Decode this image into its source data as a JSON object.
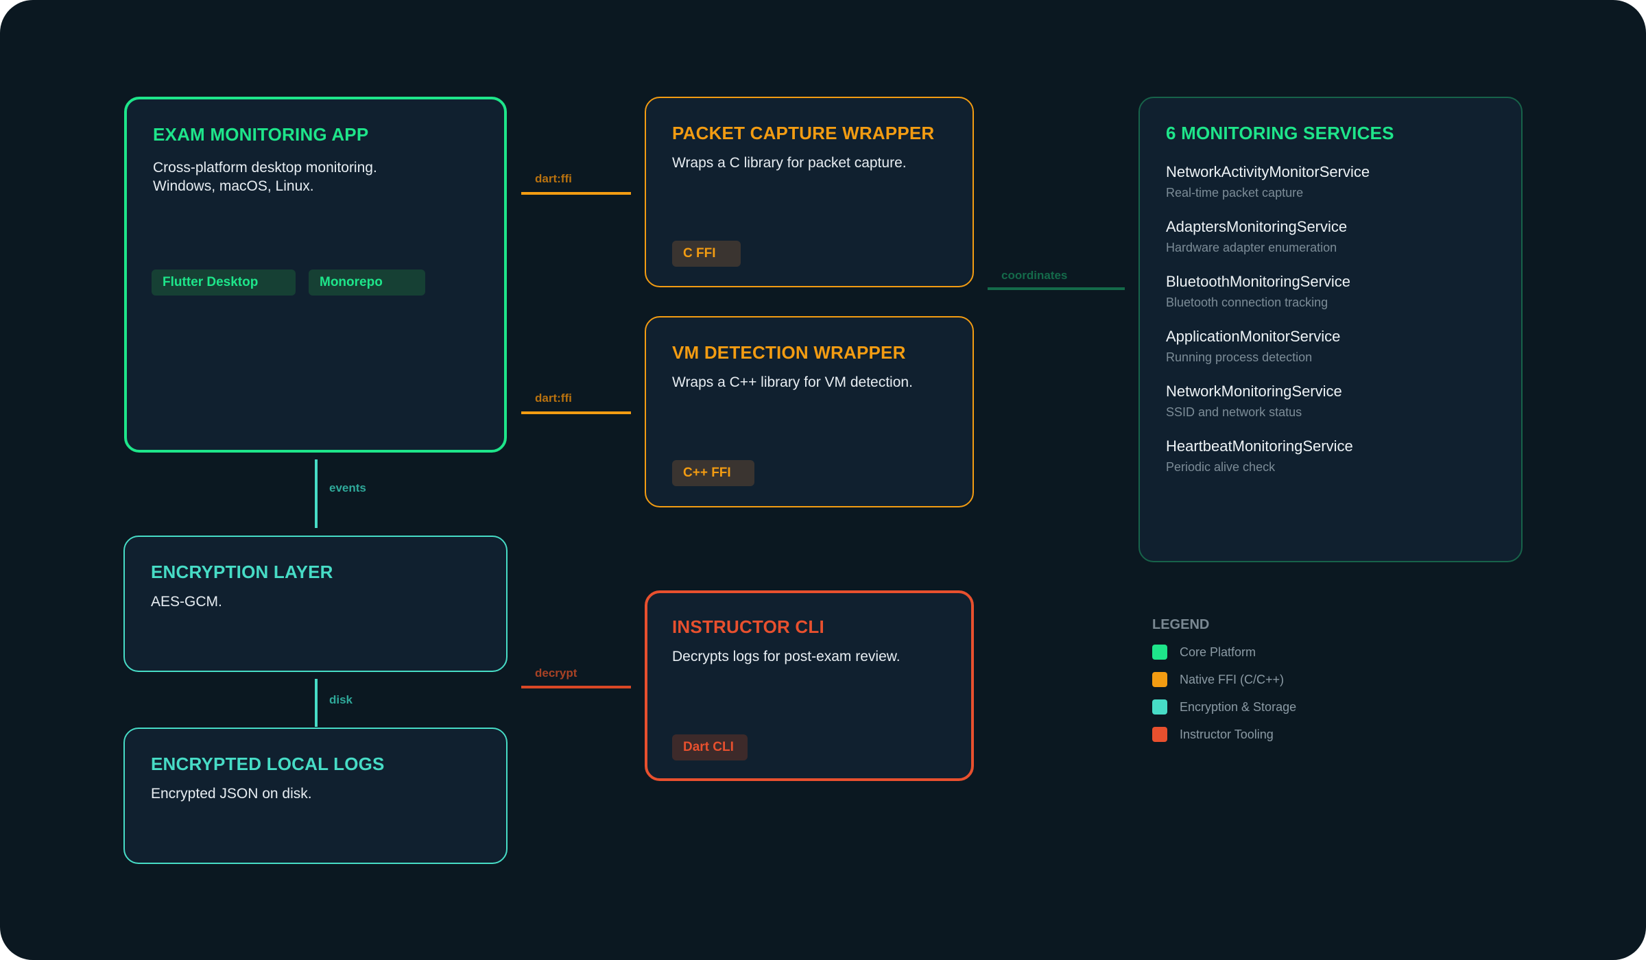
{
  "colors": {
    "background": "#0b1821",
    "core_green": "#1ee58a",
    "ffi_orange": "#f39c12",
    "encryption_teal": "#47dcc6",
    "instructor_red": "#e8502e"
  },
  "app": {
    "title": "EXAM MONITORING APP",
    "description": "Cross-platform desktop monitoring.\nWindows, macOS, Linux.",
    "tags": [
      "Flutter Desktop",
      "Monorepo"
    ]
  },
  "packet": {
    "title": "PACKET CAPTURE WRAPPER",
    "description": "Wraps a C library for packet capture.",
    "tag": "C FFI"
  },
  "vm": {
    "title": "VM DETECTION WRAPPER",
    "description": "Wraps a C++ library for VM detection.",
    "tag": "C++ FFI"
  },
  "encryption": {
    "title": "ENCRYPTION LAYER",
    "description": "AES-GCM."
  },
  "logs": {
    "title": "ENCRYPTED LOCAL LOGS",
    "description": "Encrypted JSON on disk."
  },
  "cli": {
    "title": "INSTRUCTOR CLI",
    "description": "Decrypts logs for post-exam review.",
    "tag": "Dart CLI"
  },
  "services": {
    "title": "6 MONITORING SERVICES",
    "items": [
      {
        "name": "NetworkActivityMonitorService",
        "desc": "Real-time packet capture"
      },
      {
        "name": "AdaptersMonitoringService",
        "desc": "Hardware adapter enumeration"
      },
      {
        "name": "BluetoothMonitoringService",
        "desc": "Bluetooth connection tracking"
      },
      {
        "name": "ApplicationMonitorService",
        "desc": "Running process detection"
      },
      {
        "name": "NetworkMonitoringService",
        "desc": "SSID and network status"
      },
      {
        "name": "HeartbeatMonitoringService",
        "desc": "Periodic alive check"
      }
    ]
  },
  "connectors": {
    "ffi_packet": "dart:ffi",
    "ffi_vm": "dart:ffi",
    "coordinates": "coordinates",
    "events": "events",
    "disk": "disk",
    "decrypt": "decrypt"
  },
  "legend": {
    "title": "LEGEND",
    "items": [
      {
        "label": "Core Platform",
        "color": "#1ee58a"
      },
      {
        "label": "Native FFI (C/C++)",
        "color": "#f39c12"
      },
      {
        "label": "Encryption & Storage",
        "color": "#47dcc6"
      },
      {
        "label": "Instructor Tooling",
        "color": "#e8502e"
      }
    ]
  }
}
